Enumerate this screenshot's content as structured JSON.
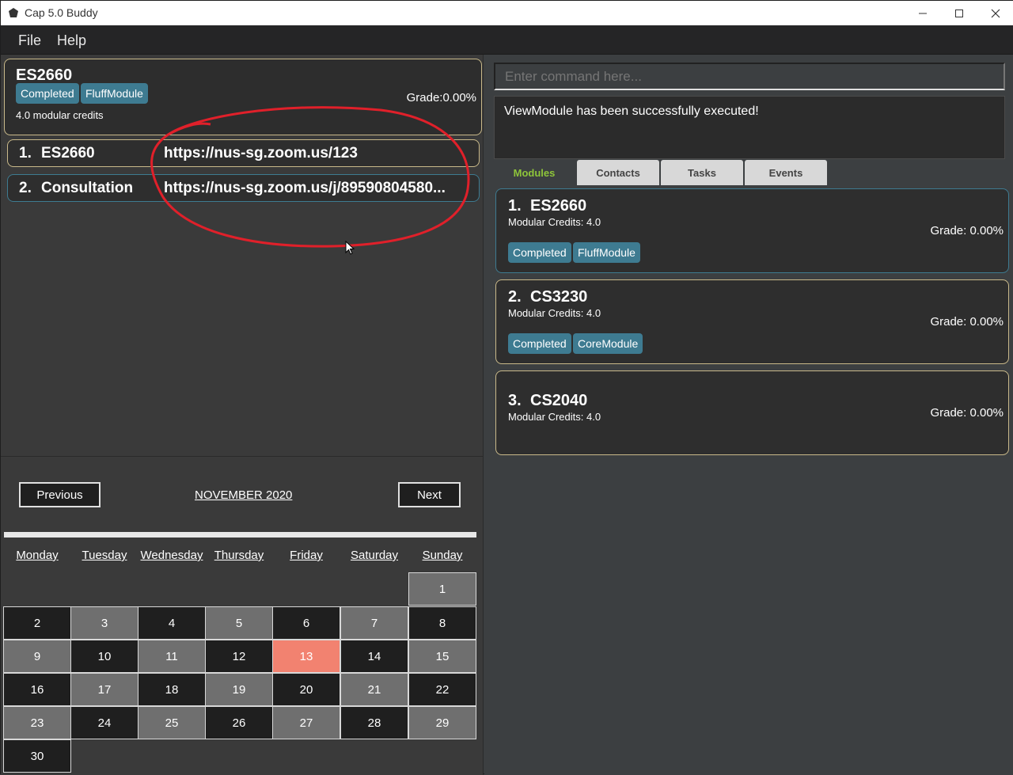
{
  "window": {
    "title": "Cap 5.0 Buddy"
  },
  "menu": {
    "file": "File",
    "help": "Help"
  },
  "selected_module": {
    "code": "ES2660",
    "tags": [
      "Completed",
      "FluffModule"
    ],
    "credits": "4.0 modular credits",
    "grade": "Grade:0.00%"
  },
  "zoom_links": [
    {
      "num": "1.",
      "name": "ES2660",
      "url": "https://nus-sg.zoom.us/123"
    },
    {
      "num": "2.",
      "name": "Consultation",
      "url": "https://nus-sg.zoom.us/j/89590804580..."
    }
  ],
  "calendar": {
    "prev_label": "Previous",
    "next_label": "Next",
    "month": "NOVEMBER 2020",
    "weekdays": [
      "Monday",
      "Tuesday",
      "Wednesday",
      "Thursday",
      "Friday",
      "Saturday",
      "Sunday"
    ],
    "highlighted_day": "13"
  },
  "command": {
    "placeholder": "Enter command here..."
  },
  "result": {
    "text": "ViewModule has been successfully executed!"
  },
  "tabs": [
    "Modules",
    "Contacts",
    "Tasks",
    "Events"
  ],
  "modules": [
    {
      "num": "1.",
      "code": "ES2660",
      "credits": "Modular Credits: 4.0",
      "grade": "Grade: 0.00%",
      "tags": [
        "Completed",
        "FluffModule"
      ]
    },
    {
      "num": "2.",
      "code": "CS3230",
      "credits": "Modular Credits: 4.0",
      "grade": "Grade: 0.00%",
      "tags": [
        "Completed",
        "CoreModule"
      ]
    },
    {
      "num": "3.",
      "code": "CS2040",
      "credits": "Modular Credits: 4.0",
      "grade": "Grade: 0.00%",
      "tags": []
    }
  ],
  "colors": {
    "tag": "#3e7b91",
    "today": "#f28270",
    "active_tab": "#8ec53a",
    "annotation": "#e0202a"
  }
}
